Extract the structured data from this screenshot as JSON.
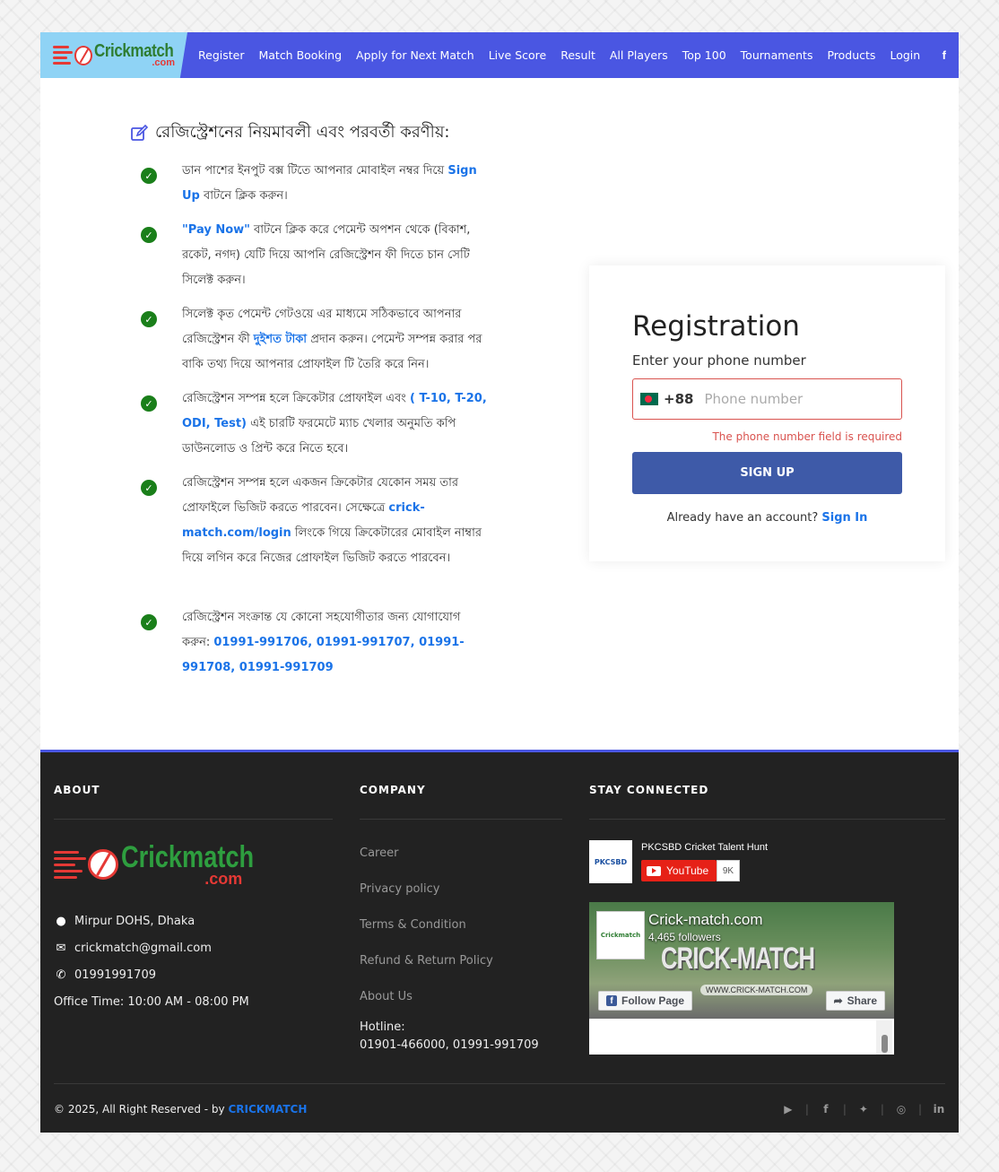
{
  "nav": {
    "logo_text": "Crickmatch",
    "logo_sub": ".com",
    "items": [
      "Register",
      "Match Booking",
      "Apply for Next Match",
      "Live Score",
      "Result",
      "All Players",
      "Top 100",
      "Tournaments",
      "Products",
      "Login"
    ],
    "facebook_icon": "f"
  },
  "rules": {
    "title": "রেজিস্ট্রেশনের নিয়মাবলী এবং পরবর্তী করণীয়:",
    "items": [
      {
        "pre": "ডান পাশের ইনপুট বক্স টিতে আপনার মোবাইল নম্বর দিয়ে ",
        "hl": "Sign Up",
        "post": " বাটনে ক্লিক করুন।"
      },
      {
        "pre": "",
        "hl": "\"Pay Now\"",
        "post": " বাটনে ক্লিক করে পেমেন্ট অপশন থেকে (বিকাশ, রকেট, নগদ) যেটি দিয়ে আপনি রেজিস্ট্রেশন ফী দিতে চান সেটি সিলেক্ট করুন।"
      },
      {
        "pre": "সিলেক্ট কৃত পেমেন্ট গেটওয়ে এর মাধ্যমে সঠিকভাবে আপনার রেজিস্ট্রেশন ফী ",
        "hl": "দুইশত টাকা",
        "post": " প্রদান করুন। পেমেন্ট সম্পন্ন করার পর বাকি তথ্য দিয়ে আপনার প্রোফাইল টি তৈরি করে নিন।"
      },
      {
        "pre": "রেজিস্ট্রেশন সম্পন্ন হলে ক্রিকেটার প্রোফাইল এবং ",
        "hl": "( T-10, T-20, ODI, Test)",
        "post": " এই চারটি ফরমেটে ম্যাচ খেলার অনুমতি কপি ডাউনলোড ও প্রিন্ট করে নিতে হবে।"
      },
      {
        "pre": "রেজিস্ট্রেশন সম্পন্ন হলে একজন ক্রিকেটার যেকোন সময় তার প্রোফাইলে ভিজিট করতে পারবেন। সেক্ষেত্রে ",
        "hl": "crick-match.com/login",
        "post": " লিংকে গিয়ে ক্রিকেটারের মোবাইল নাম্বার দিয়ে লগিন করে নিজের প্রোফাইল ভিজিট করতে পারবেন।"
      },
      {
        "pre": "রেজিস্ট্রেশন সংক্রান্ত যে কোনো সহযোগীতার জন্য যোগাযোগ করুন: ",
        "hl": "01991-991706, 01991-991707, 01991-991708, 01991-991709",
        "post": ""
      }
    ]
  },
  "registration": {
    "title": "Registration",
    "subtitle": "Enter your phone number",
    "country_code": "+88",
    "phone_placeholder": "Phone number",
    "phone_value": "",
    "error": "The phone number field is required",
    "signup_label": "SIGN UP",
    "signin_prompt": "Already have an account?",
    "signin_label": "Sign In"
  },
  "footer": {
    "about_heading": "ABOUT",
    "company_heading": "COMPANY",
    "stay_heading": "STAY CONNECTED",
    "logo_text": "Crickmatch",
    "logo_sub": ".com",
    "address": "Mirpur DOHS, Dhaka",
    "email": "crickmatch@gmail.com",
    "phone": "01991991709",
    "office_time": "Office Time: 10:00 AM - 08:00 PM",
    "links": [
      "Career",
      "Privacy policy",
      "Terms & Condition",
      "Refund & Return Policy",
      "About Us"
    ],
    "hotline_label": "Hotline:",
    "hotline_value": "01901-466000, 01991-991709",
    "youtube": {
      "channel": "PKCSBD Cricket Talent Hunt",
      "thumb": "PKCSBD",
      "button": "YouTube",
      "count": "9K"
    },
    "facebook": {
      "name": "Crick-match.com",
      "followers": "4,465 followers",
      "cover_title": "CRICK-MATCH",
      "cover_url": "WWW.CRICK-MATCH.COM",
      "profile": "Crickmatch",
      "follow": "Follow Page",
      "share": "Share"
    },
    "copyright_prefix": "© 2025, All Right Reserved - by ",
    "copyright_brand": "CRICKMATCH",
    "social_icons": [
      "youtube-icon",
      "facebook-icon",
      "twitter-icon",
      "instagram-icon",
      "linkedin-icon"
    ]
  },
  "colors": {
    "nav": "#4a56e2",
    "accent": "#1a73e8",
    "check": "#1a7f1a",
    "error": "#d9534f",
    "button": "#3e5aa8",
    "footer": "#222222"
  }
}
